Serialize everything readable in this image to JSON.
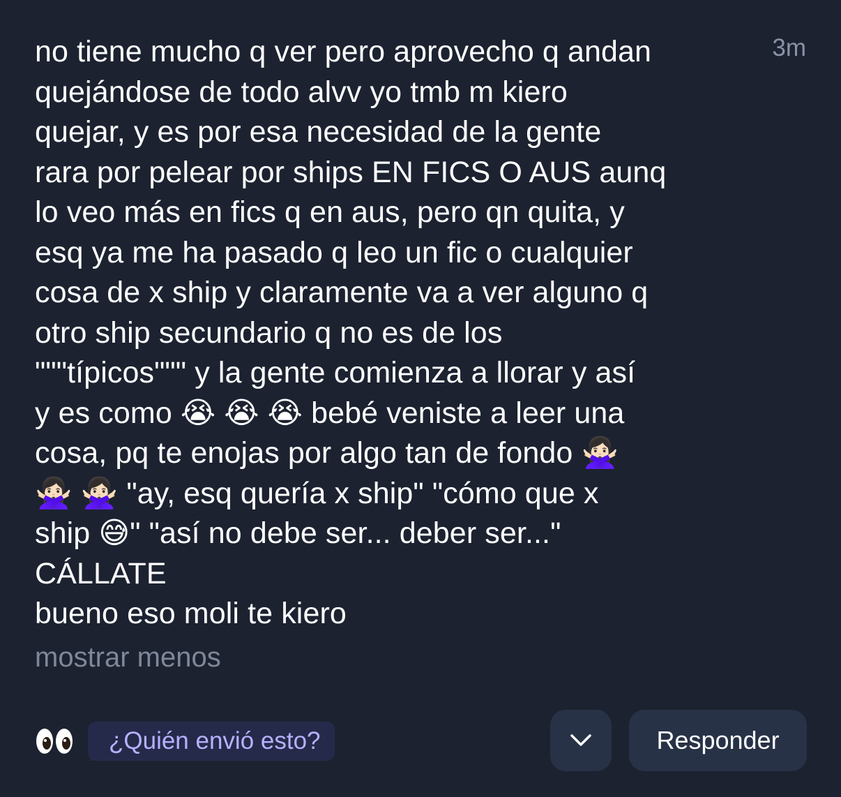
{
  "message": {
    "lines": [
      "no tiene mucho q ver pero aprovecho q andan",
      "quejándose de todo alvv yo tmb m kiero",
      "quejar, y es por esa necesidad de la gente",
      "rara por pelear por ships EN FICS O AUS aunq",
      "lo veo más en fics q en aus, pero qn quita, y",
      "esq ya me ha pasado q leo un fic o cualquier",
      "cosa de x ship y claramente va a ver alguno q",
      "otro ship secundario q no es de los",
      "\"\"\"típicos\"\"\" y la gente comienza a llorar y así",
      "y es como 😭 😭 😭  bebé veniste a leer una",
      "cosa, pq te enojas por algo tan de fondo 🙅🏻‍♀️",
      "🙅🏻‍♀️ 🙅🏻‍♀️  \"ay, esq quería x ship\" \"cómo que x",
      "ship 😅\" \"así no debe ser... deber ser...\"",
      "CÁLLATE",
      "bueno eso moli te kiero"
    ],
    "timestamp": "3m",
    "show_less_label": "mostrar menos"
  },
  "footer": {
    "eyes_icon": "eyes-icon",
    "who_sent_label": "¿Quién envió esto?",
    "chevron_icon": "chevron-down-icon",
    "reply_label": "Responder"
  },
  "colors": {
    "background": "#1c2230",
    "text": "#ffffff",
    "muted": "#8a93a6",
    "button_bg": "#273246",
    "pill_bg": "#262a4a",
    "pill_text": "#b7b1ff"
  }
}
